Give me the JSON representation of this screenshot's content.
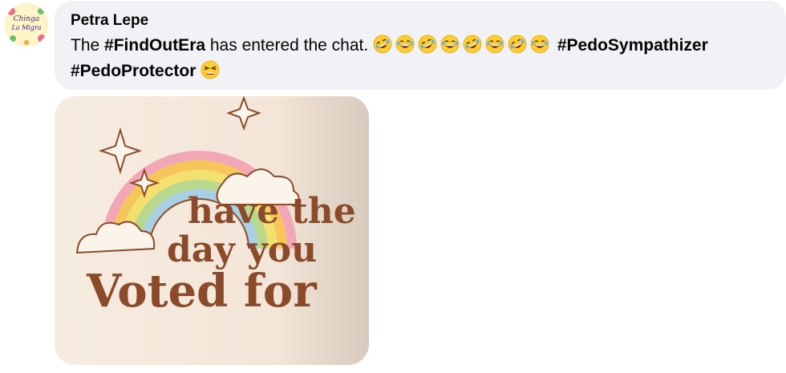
{
  "comment": {
    "author": "Petra Lepe",
    "text_parts": {
      "the": "The ",
      "hashtag1": "#FindOutEra",
      "mid": " has entered the chat. ",
      "hashtag2": "#PedoSympathizer",
      "hashtag3": "#PedoProtector"
    },
    "emojis": [
      "rolling-on-floor-laughing",
      "laughing-with-tears",
      "rolling-on-floor-laughing",
      "laughing-with-tears",
      "rolling-on-floor-laughing",
      "laughing-with-tears",
      "rolling-on-floor-laughing",
      "laughing-with-tears"
    ],
    "end_emoji": "tired-face",
    "avatar_text": {
      "line1": "Chinga",
      "line2": "La Migra"
    }
  },
  "image": {
    "line1": "have the",
    "line2": "day you",
    "line3": "Voted for"
  },
  "colors": {
    "bubble_bg": "#f0f2f5",
    "text": "#050505",
    "image_text": "#8b4b2b",
    "rainbow": [
      "#f1a7b5",
      "#f6c65a",
      "#f4e06e",
      "#b8d98c",
      "#a9cfe3"
    ]
  }
}
